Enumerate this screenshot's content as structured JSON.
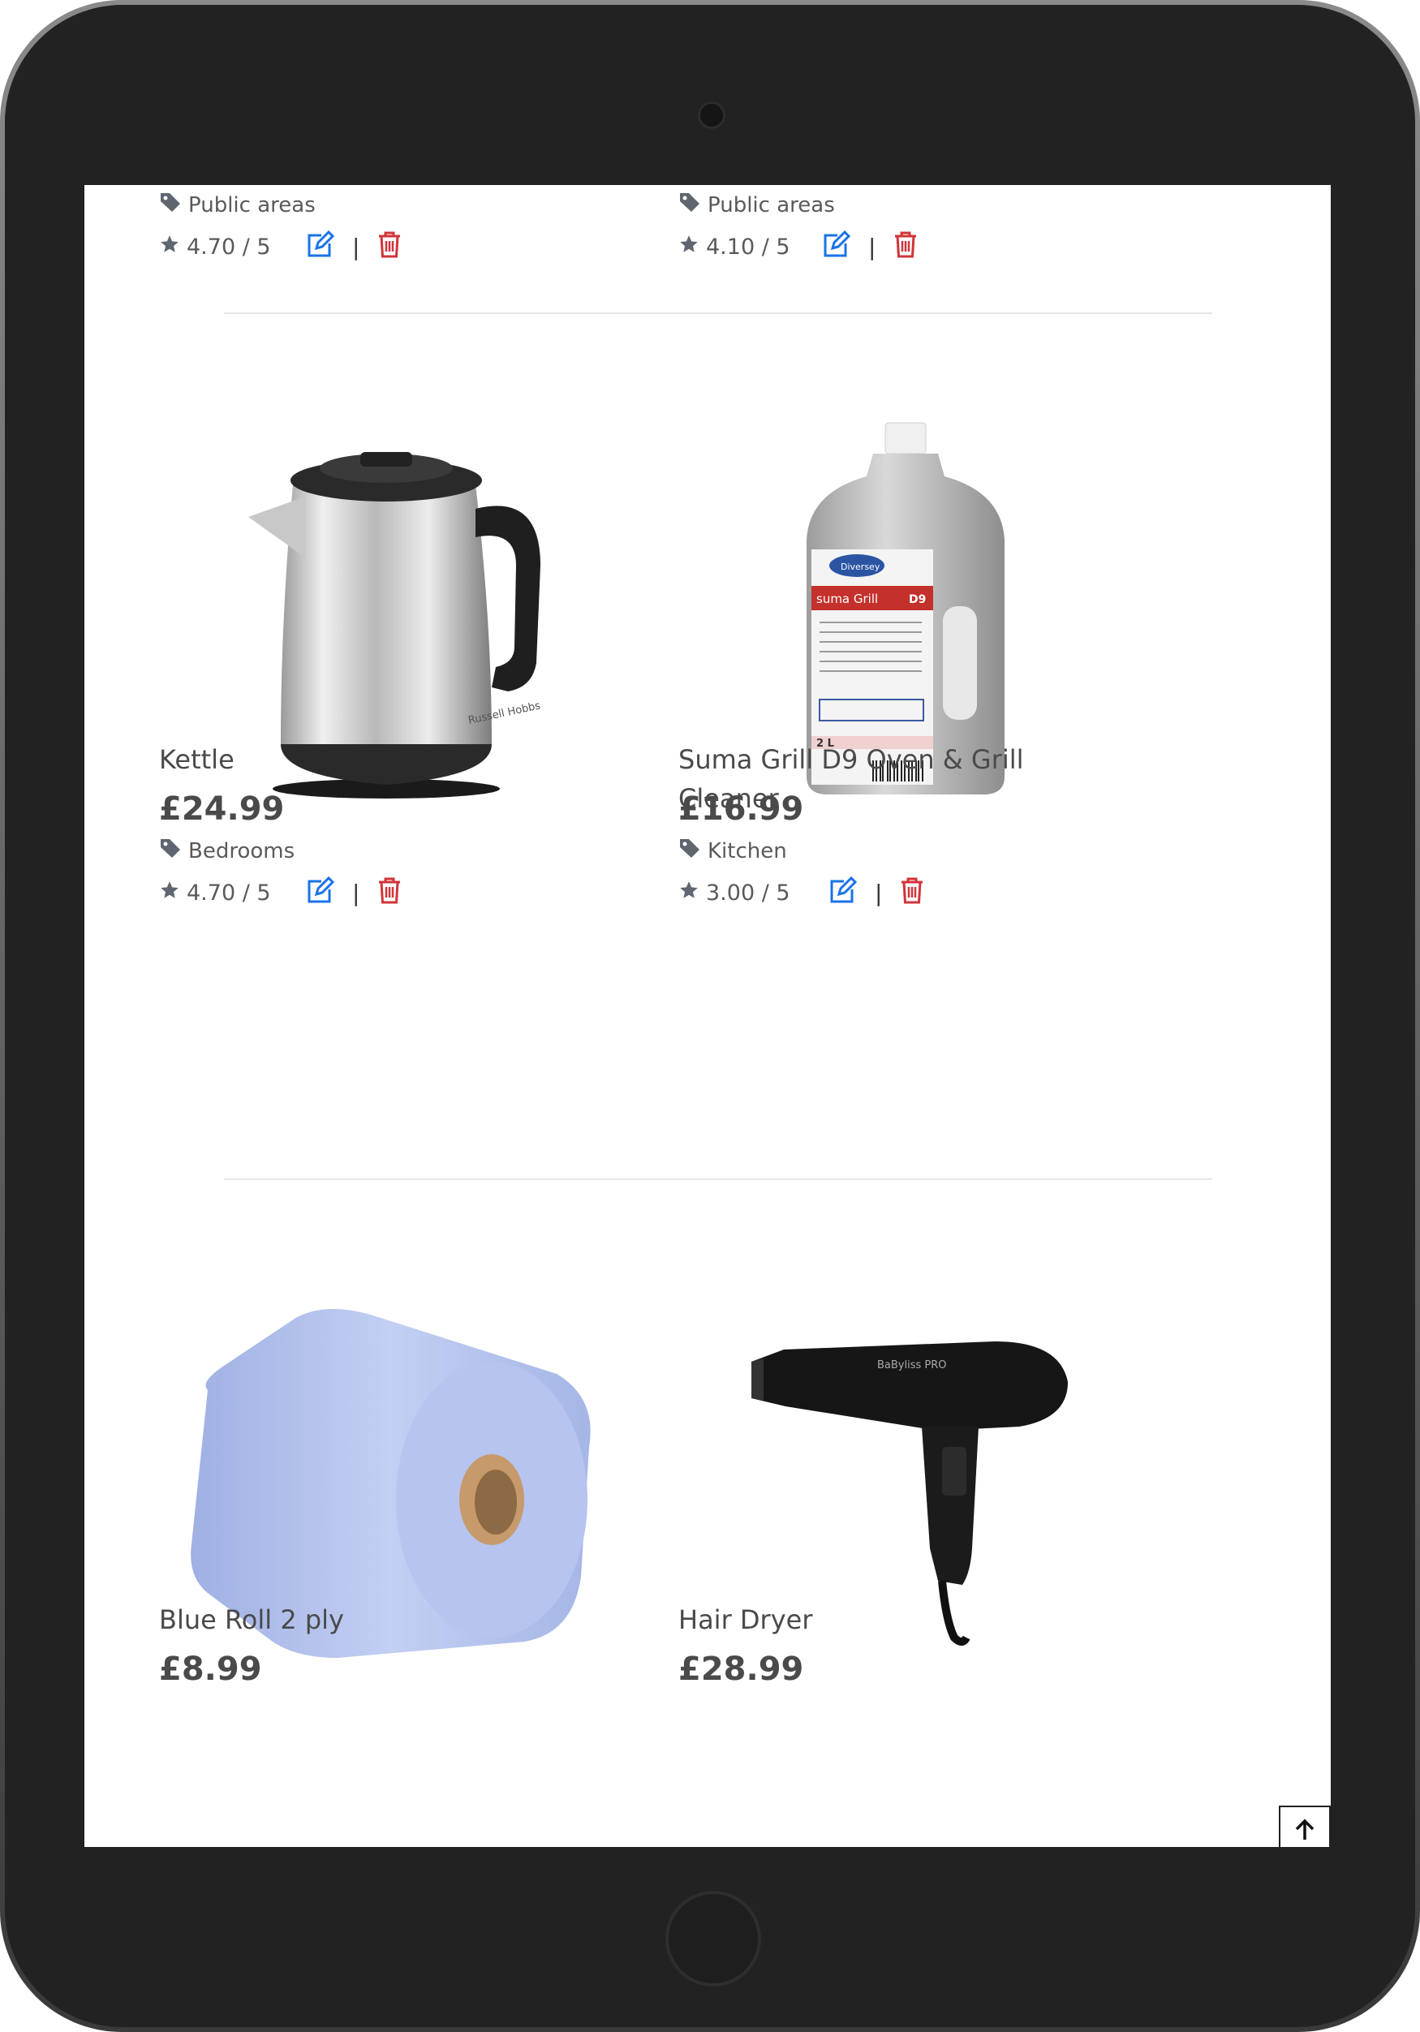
{
  "top_row": [
    {
      "category": "Public areas",
      "rating": "4.70 / 5"
    },
    {
      "category": "Public areas",
      "rating": "4.10 / 5"
    }
  ],
  "products_row2": [
    {
      "title": "Kettle",
      "price": "£24.99",
      "category": "Bedrooms",
      "rating": "4.70 / 5"
    },
    {
      "title": "Suma Grill D9 Oven & Grill Cleaner",
      "price": "£16.99",
      "category": "Kitchen",
      "rating": "3.00 / 5"
    }
  ],
  "products_row3": [
    {
      "title": "Blue Roll 2 ply",
      "price": "£8.99"
    },
    {
      "title": "Hair Dryer",
      "price": "£28.99"
    }
  ],
  "separator": "|",
  "product_labels": {
    "kettle_brand": "Russell Hobbs",
    "cleaner_brand": "Diversey",
    "cleaner_line": "suma Grill",
    "cleaner_code": "D9",
    "cleaner_volume": "2 L",
    "hairdryer_brand": "BaByliss PRO"
  },
  "colors": {
    "text": "#4a4a4a",
    "edit_blue": "#1a73e8",
    "delete_red": "#d0343a",
    "divider": "#e6e6e6"
  },
  "icons": {
    "category": "tag-icon",
    "rating": "star-icon",
    "edit": "edit-icon",
    "delete": "trash-icon",
    "scroll_top": "arrow-up-icon"
  }
}
